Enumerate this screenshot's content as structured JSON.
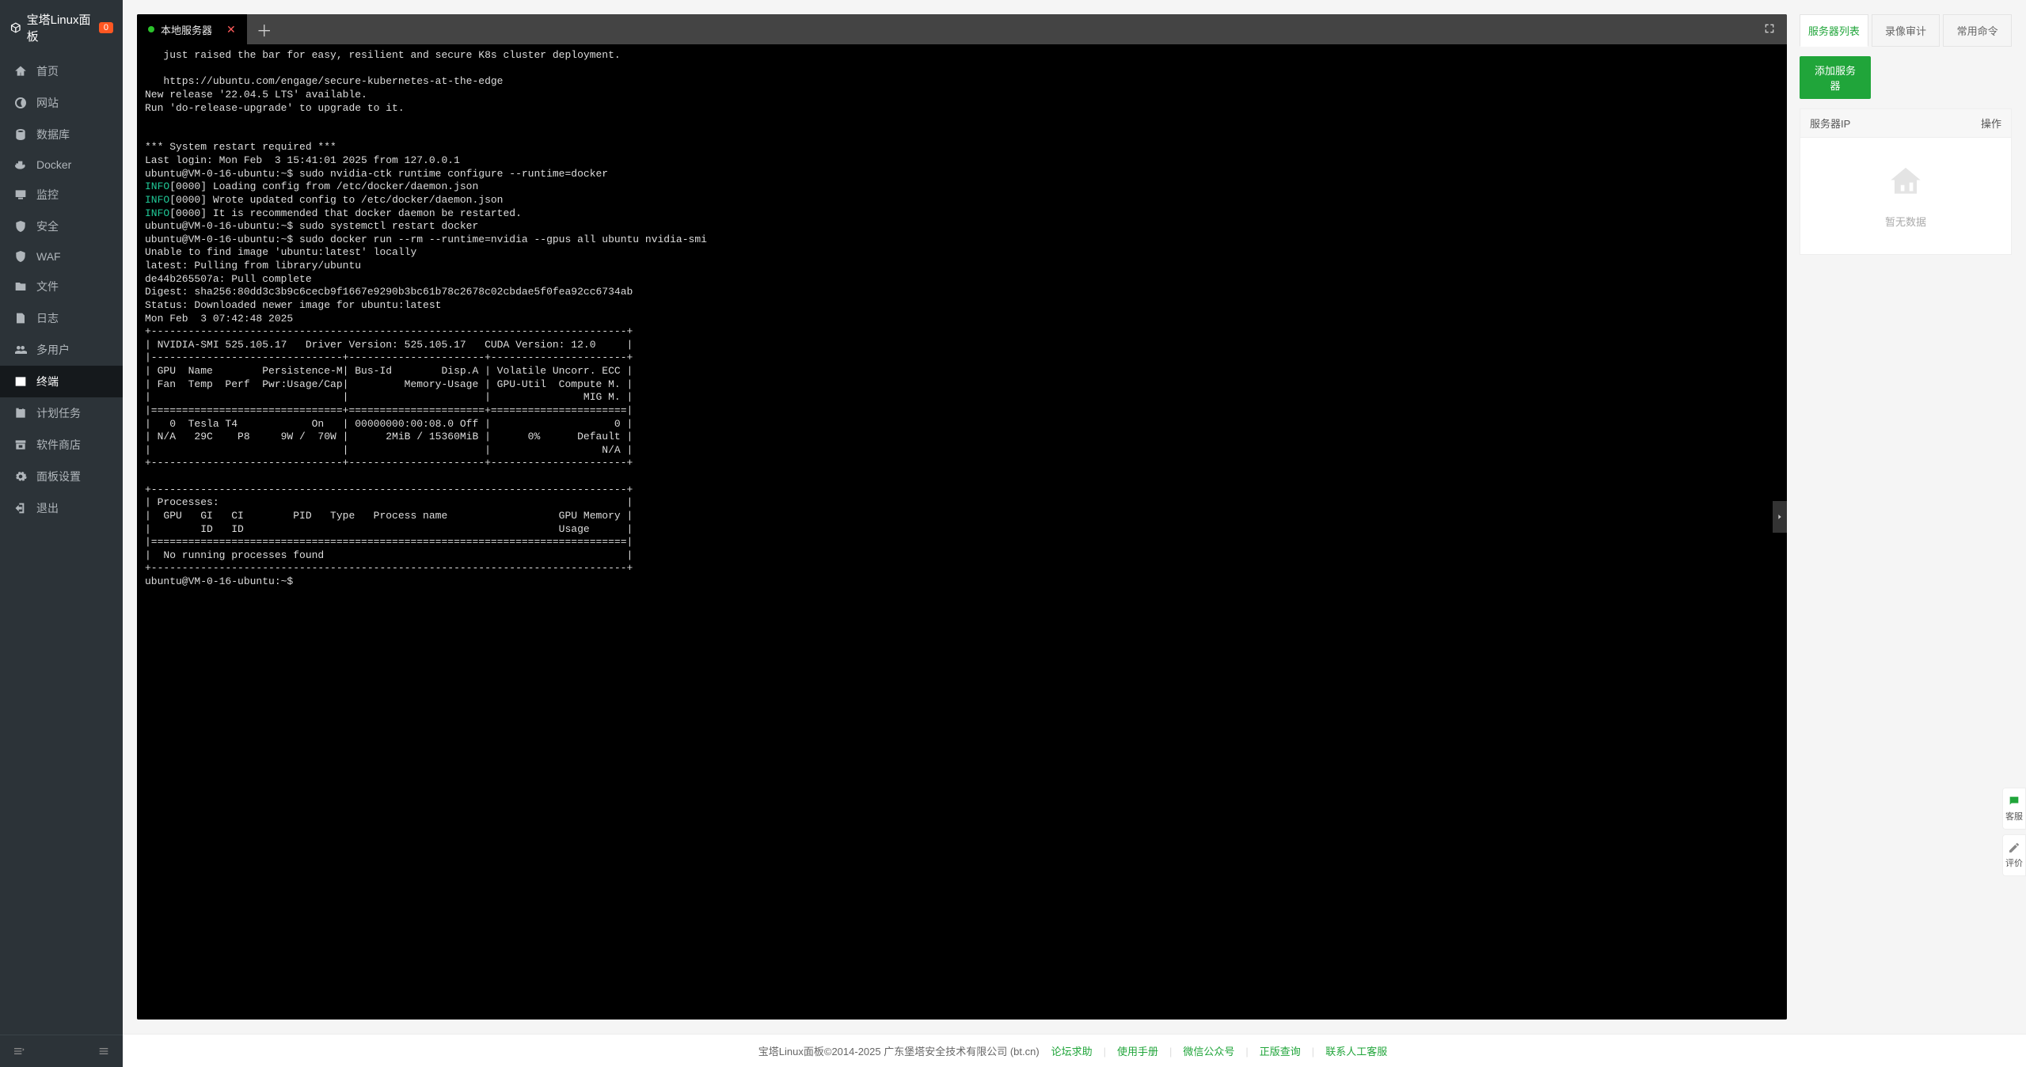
{
  "app": {
    "title": "宝塔Linux面板",
    "badge": "0"
  },
  "sidebar": {
    "items": [
      {
        "label": "首页",
        "icon": "home"
      },
      {
        "label": "网站",
        "icon": "globe"
      },
      {
        "label": "数据库",
        "icon": "db"
      },
      {
        "label": "Docker",
        "icon": "docker"
      },
      {
        "label": "监控",
        "icon": "monitor"
      },
      {
        "label": "安全",
        "icon": "shield"
      },
      {
        "label": "WAF",
        "icon": "waf"
      },
      {
        "label": "文件",
        "icon": "folder"
      },
      {
        "label": "日志",
        "icon": "log"
      },
      {
        "label": "多用户",
        "icon": "users"
      },
      {
        "label": "终端",
        "icon": "terminal"
      },
      {
        "label": "计划任务",
        "icon": "cron"
      },
      {
        "label": "软件商店",
        "icon": "store"
      },
      {
        "label": "面板设置",
        "icon": "gear"
      },
      {
        "label": "退出",
        "icon": "exit"
      }
    ],
    "active_index": 10
  },
  "terminal": {
    "tab_label": "本地服务器",
    "lines_part1": "   just raised the bar for easy, resilient and secure K8s cluster deployment.\n\n   https://ubuntu.com/engage/secure-kubernetes-at-the-edge\nNew release '22.04.5 LTS' available.\nRun 'do-release-upgrade' to upgrade to it.\n\n\n*** System restart required ***\nLast login: Mon Feb  3 15:41:01 2025 from 127.0.0.1\nubuntu@VM-0-16-ubuntu:~$ sudo nvidia-ctk runtime configure --runtime=docker",
    "info1": "INFO",
    "info1_rest": "[0000] Loading config from /etc/docker/daemon.json",
    "info2": "INFO",
    "info2_rest": "[0000] Wrote updated config to /etc/docker/daemon.json",
    "info3": "INFO",
    "info3_rest": "[0000] It is recommended that docker daemon be restarted.",
    "lines_part2": "ubuntu@VM-0-16-ubuntu:~$ sudo systemctl restart docker\nubuntu@VM-0-16-ubuntu:~$ sudo docker run --rm --runtime=nvidia --gpus all ubuntu nvidia-smi\nUnable to find image 'ubuntu:latest' locally\nlatest: Pulling from library/ubuntu\nde44b265507a: Pull complete\nDigest: sha256:80dd3c3b9c6cecb9f1667e9290b3bc61b78c2678c02cbdae5f0fea92cc6734ab\nStatus: Downloaded newer image for ubuntu:latest\nMon Feb  3 07:42:48 2025\n+-----------------------------------------------------------------------------+\n| NVIDIA-SMI 525.105.17   Driver Version: 525.105.17   CUDA Version: 12.0     |\n|-------------------------------+----------------------+----------------------+\n| GPU  Name        Persistence-M| Bus-Id        Disp.A | Volatile Uncorr. ECC |\n| Fan  Temp  Perf  Pwr:Usage/Cap|         Memory-Usage | GPU-Util  Compute M. |\n|                               |                      |               MIG M. |\n|===============================+======================+======================|\n|   0  Tesla T4            On   | 00000000:00:08.0 Off |                    0 |\n| N/A   29C    P8     9W /  70W |      2MiB / 15360MiB |      0%      Default |\n|                               |                      |                  N/A |\n+-------------------------------+----------------------+----------------------+\n\n+-----------------------------------------------------------------------------+\n| Processes:                                                                  |\n|  GPU   GI   CI        PID   Type   Process name                  GPU Memory |\n|        ID   ID                                                   Usage      |\n|=============================================================================|\n|  No running processes found                                                 |\n+-----------------------------------------------------------------------------+\nubuntu@VM-0-16-ubuntu:~$ "
  },
  "right": {
    "tabs": [
      "服务器列表",
      "录像审计",
      "常用命令"
    ],
    "add_button": "添加服务器",
    "th_ip": "服务器IP",
    "th_op": "操作",
    "empty": "暂无数据"
  },
  "footer": {
    "copyright": "宝塔Linux面板©2014-2025 广东堡塔安全技术有限公司 (bt.cn)",
    "links": [
      "论坛求助",
      "使用手册",
      "微信公众号",
      "正版查询",
      "联系人工客服"
    ]
  },
  "side_help": {
    "kf": "客服",
    "pj": "评价"
  }
}
